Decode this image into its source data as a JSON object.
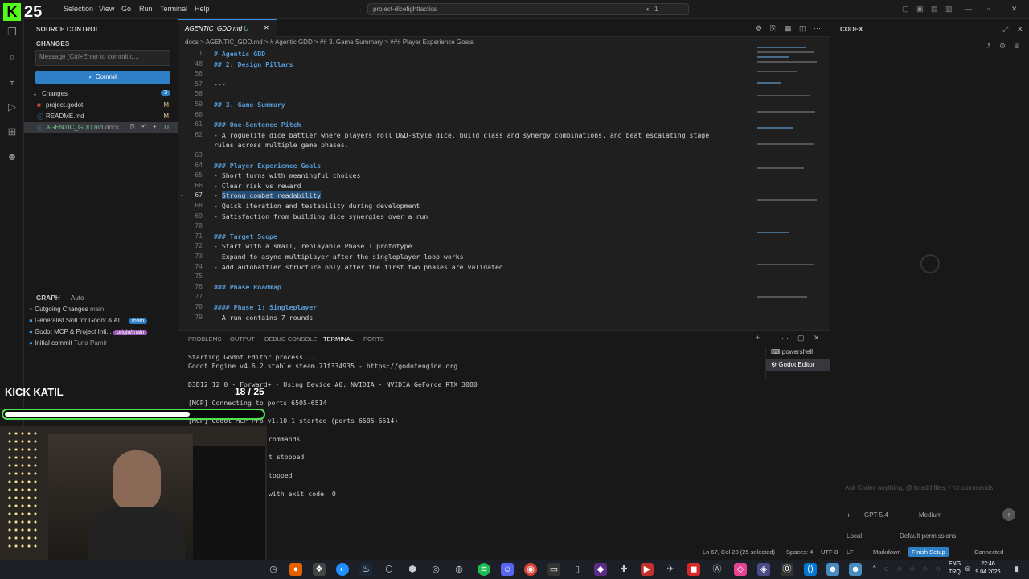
{
  "overlay": {
    "logo_text": "25",
    "streamer_label": "KICK KATIL",
    "progress_text": "18 / 25",
    "progress_fraction": 0.72
  },
  "menu": [
    "Selection",
    "View",
    "Go",
    "Run",
    "Terminal",
    "Help"
  ],
  "command_center": "project-dicefighttactics",
  "title_badge": "1",
  "sidebar": {
    "header": "SOURCE CONTROL",
    "changes_header": "CHANGES",
    "commit_placeholder": "Message (Ctrl+Enter to commit o...",
    "commit_label": "Commit",
    "changes_group": "Changes",
    "changes_count": "3",
    "files": [
      {
        "name": "project.godot",
        "status": "M",
        "dir": ""
      },
      {
        "name": "README.md",
        "status": "M",
        "dir": ""
      },
      {
        "name": "AGENTIC_GDD.md",
        "status": "U",
        "dir": "docs"
      }
    ],
    "graph_header": "GRAPH",
    "graph_auto": "Auto",
    "graph": [
      {
        "label": "Outgoing Changes",
        "ref": "main",
        "ref_style": "plain"
      },
      {
        "label": "Generalist Skill for Godot & AI ...",
        "ref": "main",
        "ref_style": "blue"
      },
      {
        "label": "Godot MCP & Project Inti...",
        "ref": "origin/main",
        "ref_style": "purple"
      },
      {
        "label": "Initial commit",
        "ref": "Tuna Pamir",
        "ref_style": "plain"
      }
    ]
  },
  "editor": {
    "tab_label": "AGENTIC_GDD.md",
    "tab_status": "U",
    "breadcrumb": "docs > AGENTIC_GDD.md > # Agentic GDD > ## 3. Game Summary > ### Player Experience Goals",
    "lines": [
      {
        "n": "1",
        "t": "# Agentic GDD",
        "h": true
      },
      {
        "n": "48",
        "t": "## 2. Design Pillars",
        "h": true
      },
      {
        "n": "56",
        "t": "",
        "h": false
      },
      {
        "n": "57",
        "t": "---",
        "h": false
      },
      {
        "n": "58",
        "t": "",
        "h": false
      },
      {
        "n": "59",
        "t": "## 3. Game Summary",
        "h": true
      },
      {
        "n": "60",
        "t": "",
        "h": false
      },
      {
        "n": "61",
        "t": "### One-Sentence Pitch",
        "h": true
      },
      {
        "n": "62",
        "t": "- A roguelite dice battler where players roll D&D-style dice, build class and synergy combinations, and beat escalating stage",
        "h": false
      },
      {
        "n": "",
        "t": "rules across multiple game phases.",
        "h": false
      },
      {
        "n": "63",
        "t": "",
        "h": false
      },
      {
        "n": "64",
        "t": "### Player Experience Goals",
        "h": true
      },
      {
        "n": "65",
        "t": "- Short turns with meaningful choices",
        "h": false
      },
      {
        "n": "66",
        "t": "- Clear risk vs reward",
        "h": false
      },
      {
        "n": "67",
        "t": "- Strong combat readability",
        "h": false
      },
      {
        "n": "68",
        "t": "- Quick iteration and testability during development",
        "h": false
      },
      {
        "n": "69",
        "t": "- Satisfaction from building dice synergies over a run",
        "h": false
      },
      {
        "n": "70",
        "t": "",
        "h": false
      },
      {
        "n": "71",
        "t": "### Target Scope",
        "h": true
      },
      {
        "n": "72",
        "t": "- Start with a small, replayable Phase 1 prototype",
        "h": false
      },
      {
        "n": "73",
        "t": "- Expand to async multiplayer after the singleplayer loop works",
        "h": false
      },
      {
        "n": "74",
        "t": "- Add autobattler structure only after the first two phases are validated",
        "h": false
      },
      {
        "n": "75",
        "t": "",
        "h": false
      },
      {
        "n": "76",
        "t": "### Phase Roadmap",
        "h": true
      },
      {
        "n": "77",
        "t": "",
        "h": false
      },
      {
        "n": "78",
        "t": "#### Phase 1: Singleplayer",
        "h": true
      },
      {
        "n": "79",
        "t": "- A run contains 7 rounds",
        "h": false
      }
    ]
  },
  "panel": {
    "tabs": [
      "PROBLEMS",
      "OUTPUT",
      "DEBUG CONSOLE",
      "TERMINAL",
      "PORTS"
    ],
    "active_tab": "TERMINAL",
    "terminals": [
      "powershell",
      "Godot Editor"
    ],
    "output": [
      "Starting Godot Editor process...",
      "Godot Engine v4.6.2.stable.steam.71f334935 - https://godotengine.org",
      "",
      "D3D12 12_0 - Forward+ - Using Device #0: NVIDIA - NVIDIA GeForce RTX 3080",
      "",
      "[MCP] Connecting to ports 6505-6514",
      "",
      "[MCP] Godot MCP Pro v1.10.1 started (ports 6505-6514)",
      "",
      "commands",
      "",
      "t stopped",
      "",
      "topped",
      "",
      "with exit code: 0"
    ]
  },
  "codex": {
    "title": "CODEX",
    "placeholder": "Ask Codex anything, @ to add files, / for commands",
    "model": "GPT-5.4",
    "effort": "Medium",
    "mode": "Local",
    "permissions": "Default permissions"
  },
  "statusbar": {
    "position": "Ln 67, Col 28 (25 selected)",
    "spaces": "Spaces: 4",
    "encoding": "UTF-8",
    "eol": "LF",
    "language": "Markdown",
    "finish_setup": "Finish Setup",
    "connection": "Connected"
  },
  "taskbar": {
    "lang": "ENG",
    "region": "TRQ",
    "time": "22:46",
    "date": "9.04.2026"
  }
}
